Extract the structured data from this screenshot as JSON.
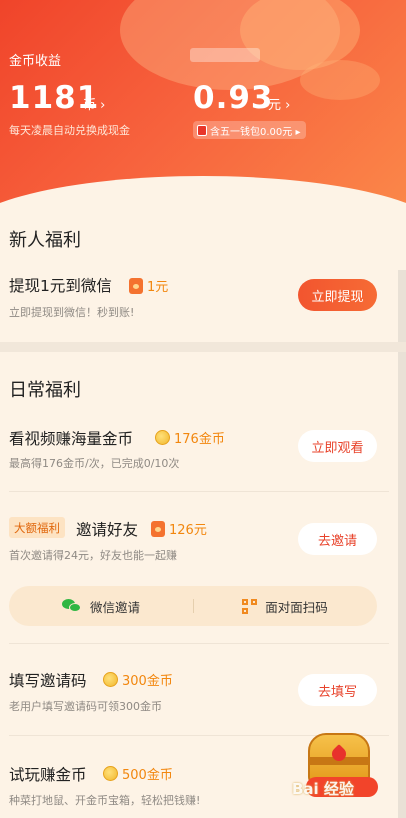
{
  "header": {
    "label": "金币收益",
    "coins": "1181",
    "coin_unit": "币 ›",
    "coin_hint": "每天凌晨自动兑换成现金",
    "cash": "0.93",
    "cash_unit": "元 ›",
    "cash_badge": "含五一钱包0.00元 ▸",
    "colors": {
      "start": "#f0442a",
      "end": "#fb8a4a"
    }
  },
  "newbie": {
    "title": "新人福利",
    "task": {
      "title": "提现1元到微信",
      "reward": "1元",
      "reward_icon": "red-packet-icon",
      "subtitle": "立即提现到微信！秒到账!",
      "button": "立即提现"
    }
  },
  "daily": {
    "title": "日常福利",
    "tasks": [
      {
        "title": "看视频赚海量金币",
        "reward": "176金币",
        "reward_icon": "coin-icon",
        "subtitle": "最高得176金币/次，已完成0/10次",
        "button": "立即观看"
      },
      {
        "tag": "大额福利",
        "title": "邀请好友",
        "reward": "126元",
        "reward_icon": "red-packet-icon",
        "subtitle": "首次邀请得24元，好友也能一起赚",
        "button": "去邀请"
      },
      {
        "title": "填写邀请码",
        "reward": "300金币",
        "reward_icon": "coin-icon",
        "subtitle": "老用户填写邀请码可领300金币",
        "button": "去填写"
      },
      {
        "title": "试玩赚金币",
        "reward": "500金币",
        "reward_icon": "coin-icon",
        "subtitle": "种菜打地鼠、开金币宝箱，轻松把钱赚!"
      }
    ],
    "share": {
      "wechat": "微信邀请",
      "qr": "面对面扫码"
    }
  },
  "watermark": "Bai 经验"
}
